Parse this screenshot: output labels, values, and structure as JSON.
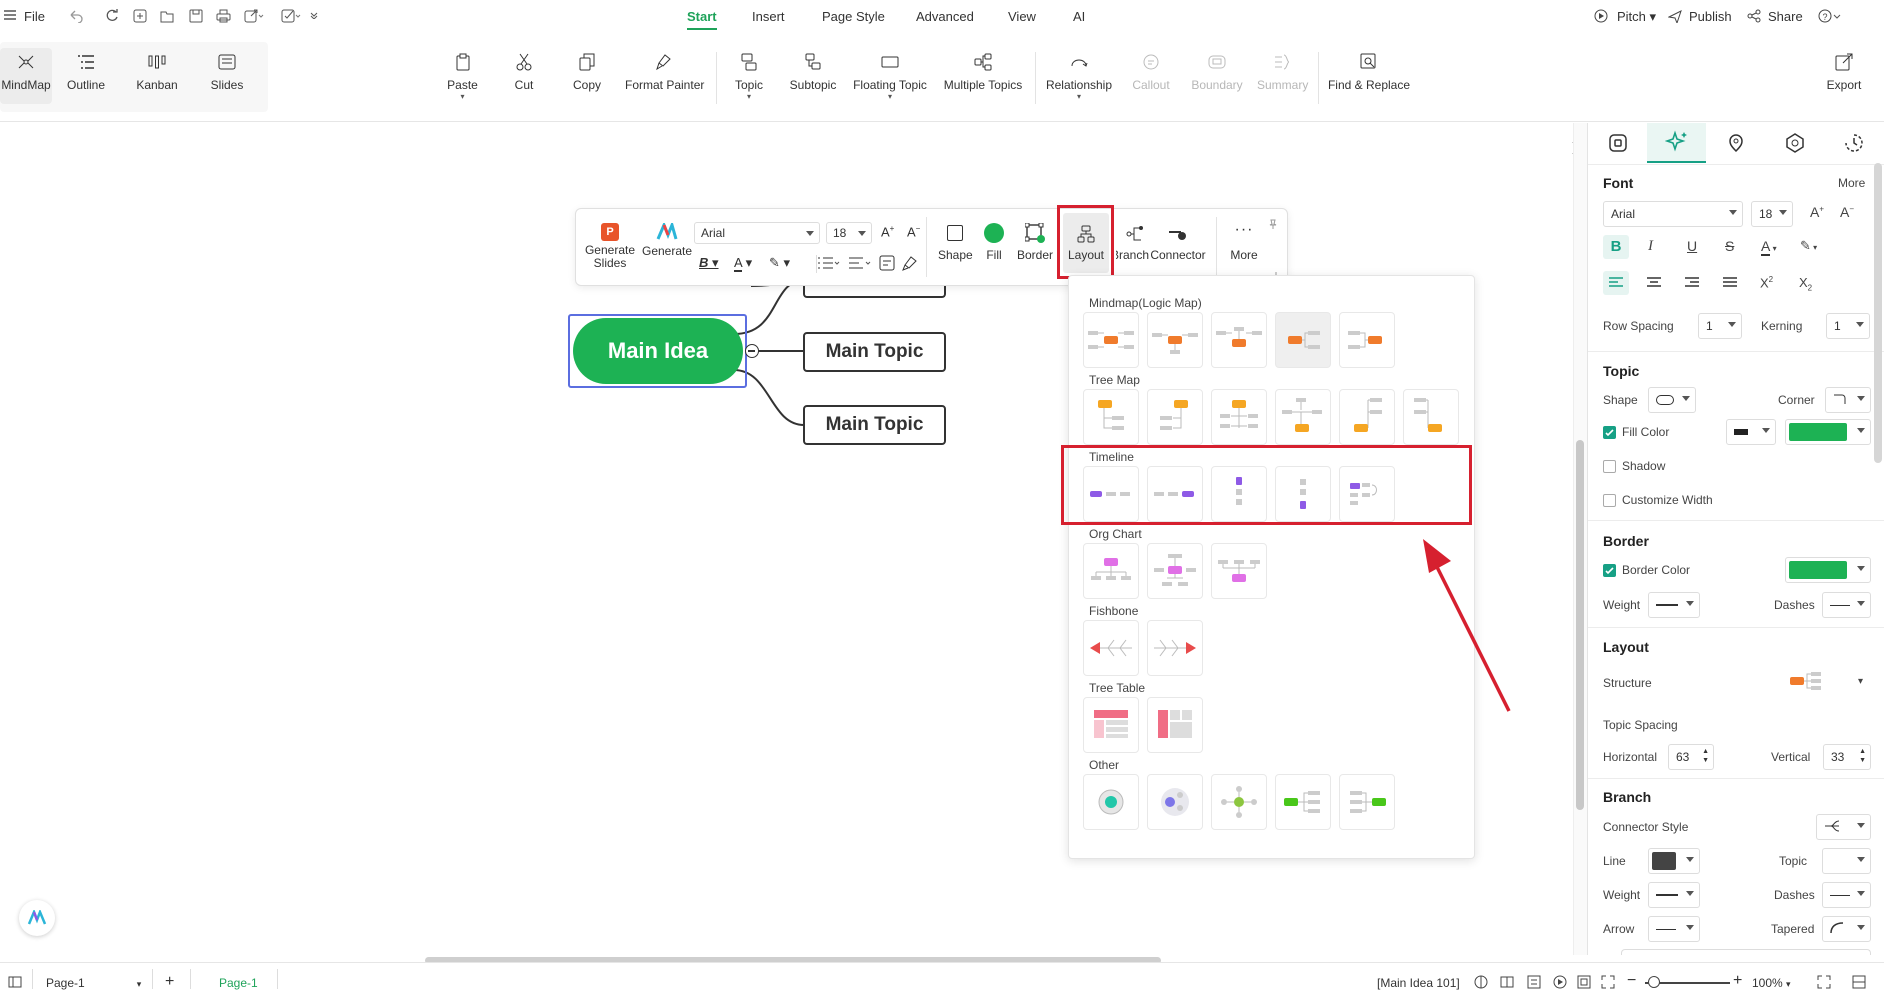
{
  "menubar": {
    "file": "File",
    "tabs": [
      {
        "label": "Start",
        "active": true
      },
      {
        "label": "Insert"
      },
      {
        "label": "Page Style"
      },
      {
        "label": "Advanced"
      },
      {
        "label": "View"
      },
      {
        "label": "AI"
      }
    ],
    "pitch": "Pitch",
    "publish": "Publish",
    "share": "Share"
  },
  "views": [
    "MindMap",
    "Outline",
    "Kanban",
    "Slides"
  ],
  "ribbon": {
    "paste": "Paste",
    "cut": "Cut",
    "copy": "Copy",
    "format_painter": "Format Painter",
    "topic": "Topic",
    "subtopic": "Subtopic",
    "floating_topic": "Floating Topic",
    "multiple_topics": "Multiple Topics",
    "relationship": "Relationship",
    "callout": "Callout",
    "boundary": "Boundary",
    "summary": "Summary",
    "find_replace": "Find & Replace",
    "export": "Export"
  },
  "canvas": {
    "main_idea": "Main Idea",
    "topics": [
      "Main Topic",
      "Main Topic"
    ],
    "main_color": "#1db254"
  },
  "floating_toolbar": {
    "generate_slides": "Generate Slides",
    "generate": "Generate",
    "font": "Arial",
    "size": "18",
    "shape": "Shape",
    "fill": "Fill",
    "border": "Border",
    "layout": "Layout",
    "branch": "Branch",
    "connector": "Connector",
    "more": "More"
  },
  "layout_dropdown": {
    "sections": [
      "Mindmap(Logic Map)",
      "Tree Map",
      "Timeline",
      "Org Chart",
      "Fishbone",
      "Tree Table",
      "Other"
    ]
  },
  "panel": {
    "font_header": "Font",
    "more": "More",
    "font": "Arial",
    "font_size": "18",
    "row_spacing_label": "Row Spacing",
    "row_spacing": "1",
    "kerning_label": "Kerning",
    "kerning": "1",
    "topic_header": "Topic",
    "shape_label": "Shape",
    "corner_label": "Corner",
    "fill_color_label": "Fill Color",
    "shadow_label": "Shadow",
    "customize_width_label": "Customize Width",
    "border_header": "Border",
    "border_color_label": "Border Color",
    "weight_label": "Weight",
    "dashes_label": "Dashes",
    "layout_header": "Layout",
    "structure_label": "Structure",
    "topic_spacing_label": "Topic Spacing",
    "horizontal_label": "Horizontal",
    "horizontal": "63",
    "vertical_label": "Vertical",
    "vertical": "33",
    "branch_header": "Branch",
    "connector_style_label": "Connector Style",
    "line_label": "Line",
    "topic_label": "Topic",
    "weight2_label": "Weight",
    "dashes2_label": "Dashes",
    "arrow_label": "Arrow",
    "tapered_label": "Tapered",
    "accent": "#1db254"
  },
  "status": {
    "page_select": "Page-1",
    "page_tab": "Page-1",
    "main_idea_count": "[Main Idea 101]",
    "zoom": "100%"
  },
  "annotation_color": "#d6202f"
}
